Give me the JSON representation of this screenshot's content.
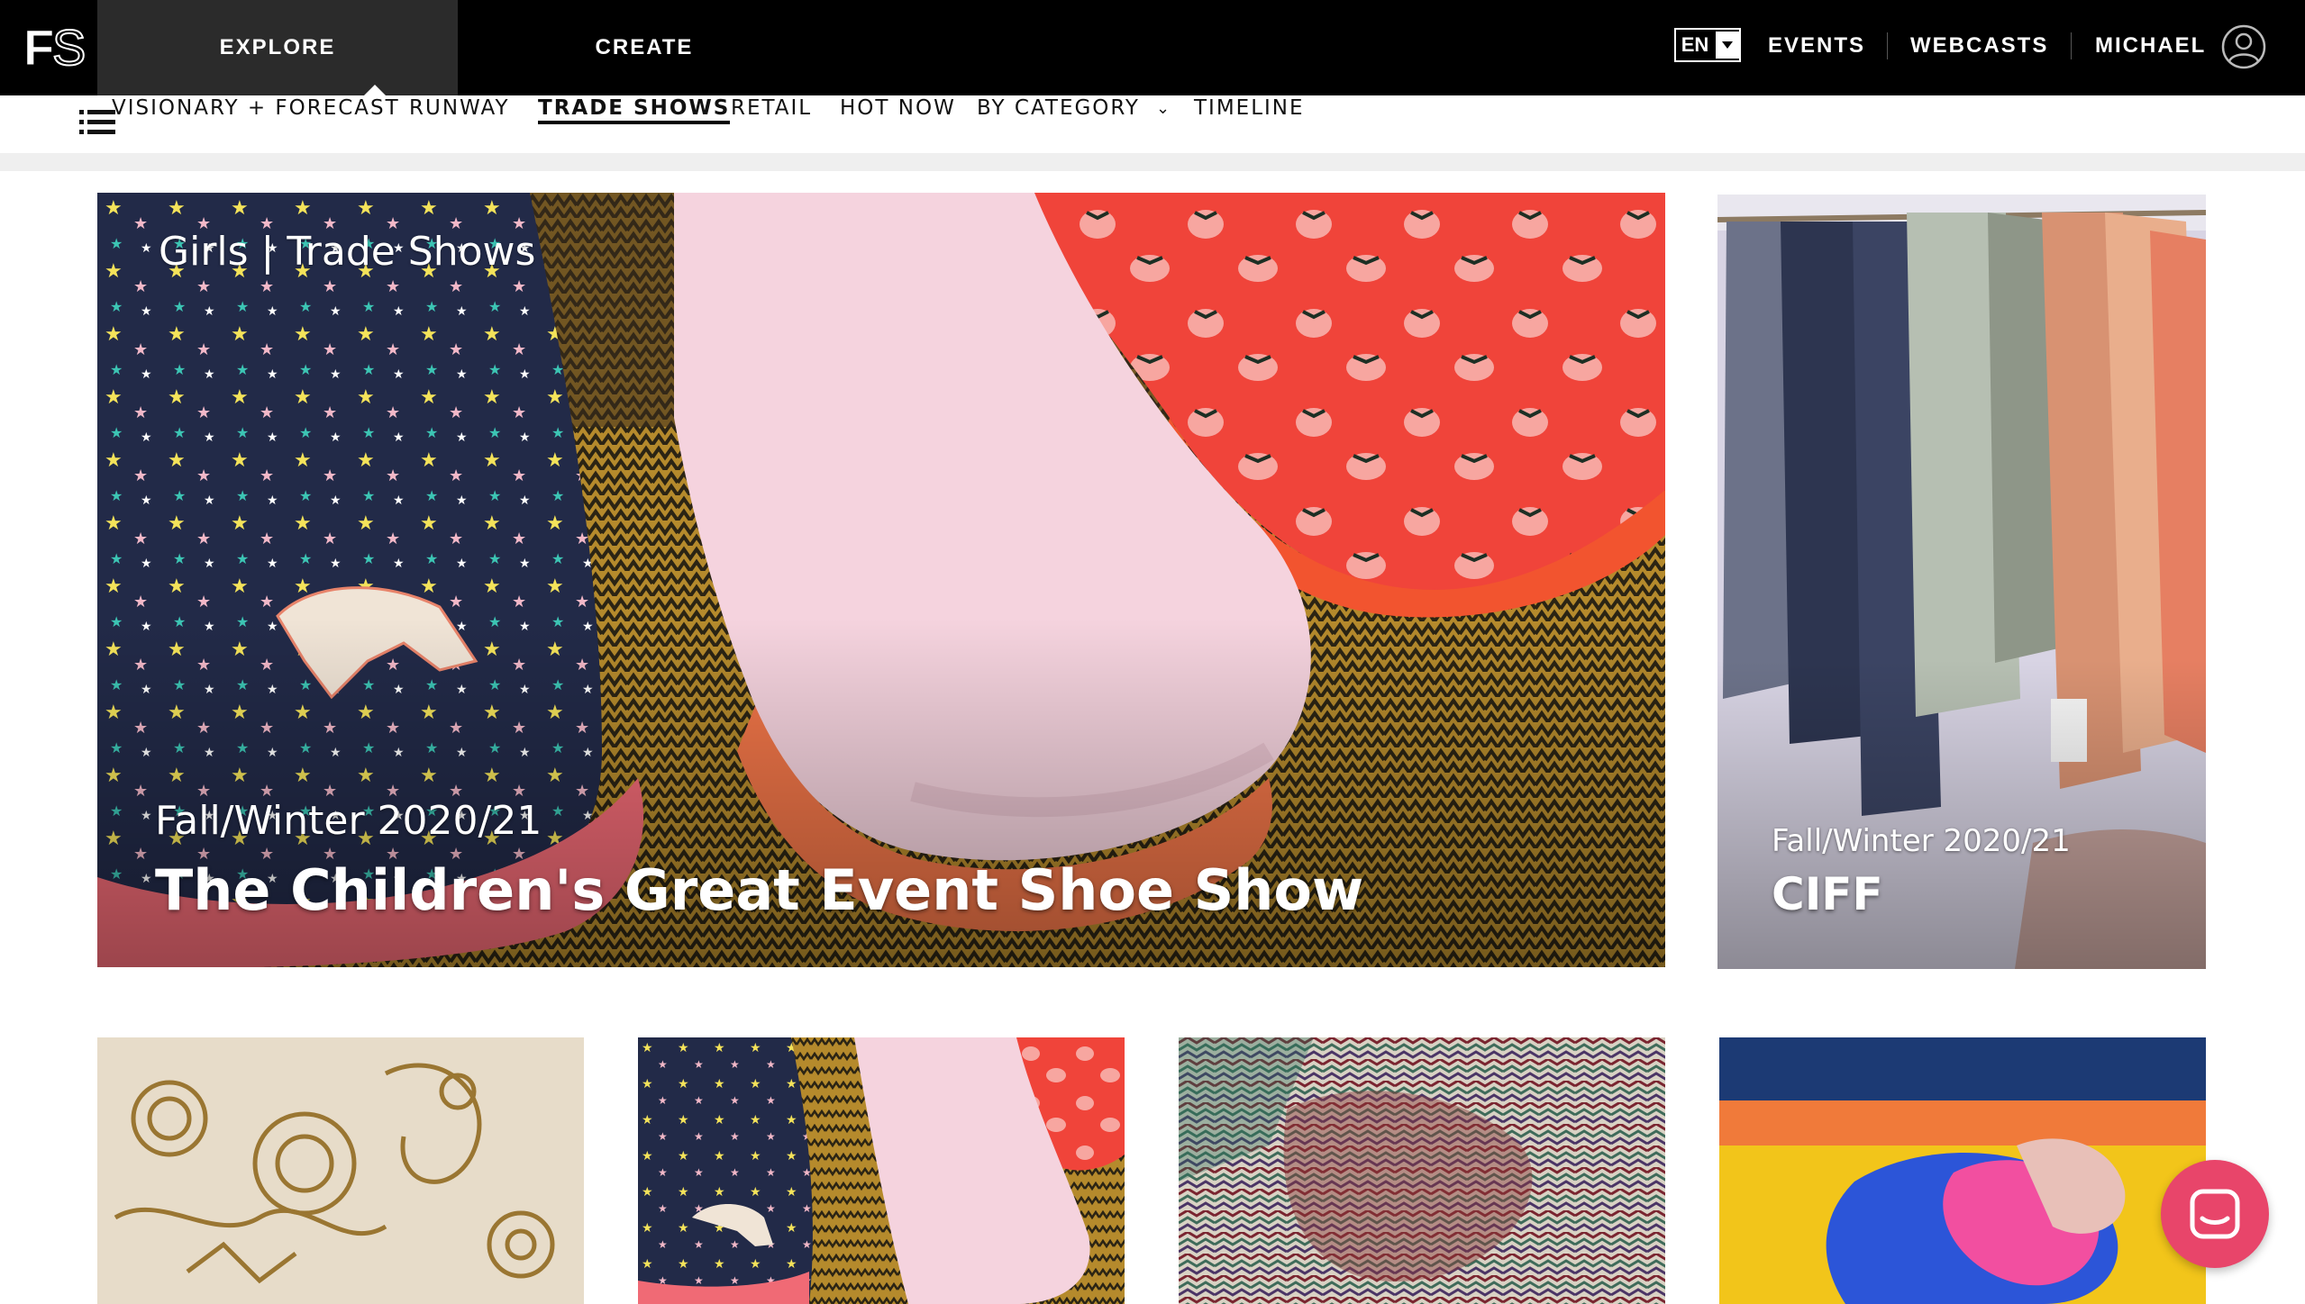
{
  "brand": {
    "logo": "FS"
  },
  "top_nav": {
    "tabs": [
      {
        "label": "EXPLORE",
        "active": true
      },
      {
        "label": "CREATE",
        "active": false
      }
    ],
    "language": "EN",
    "links": [
      "EVENTS",
      "WEBCASTS",
      "MICHAEL"
    ],
    "user_icon": "user-circle-icon"
  },
  "sub_nav": {
    "menu_icon": "list-menu-icon",
    "items": [
      {
        "label": "VISIONARY + FORECAST",
        "active": false
      },
      {
        "label": "RUNWAY",
        "active": false
      },
      {
        "label": "TRADE SHOWS",
        "active": true
      },
      {
        "label": "RETAIL",
        "active": false
      },
      {
        "label": "HOT NOW",
        "active": false
      },
      {
        "label": "BY CATEGORY",
        "active": false,
        "dropdown": true
      },
      {
        "label": "TIMELINE",
        "active": false
      }
    ]
  },
  "hero": {
    "main": {
      "kicker": "Girls | Trade Shows",
      "season": "Fall/Winter 2020/21",
      "title": "The Children's Great Event Shoe Show"
    },
    "side": {
      "season": "Fall/Winter 2020/21",
      "title": "CIFF"
    }
  },
  "chat": {
    "icon": "chat-bubble-icon"
  },
  "colors": {
    "topbar": "#000000",
    "explore_tab": "#2b2b2b",
    "chat_button": "#e8456a"
  }
}
